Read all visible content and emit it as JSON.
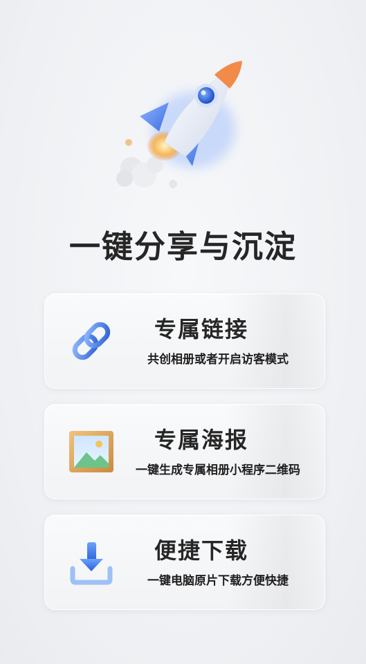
{
  "headline": "一键分享与沉淀",
  "features": [
    {
      "title": "专属链接",
      "subtitle": "共创相册或者开启访客模式",
      "icon": "chain-link-icon"
    },
    {
      "title": "专属海报",
      "subtitle": "一键生成专属相册小程序二维码",
      "icon": "framed-picture-icon"
    },
    {
      "title": "便捷下载",
      "subtitle": "一键电脑原片下载方便快捷",
      "icon": "download-tray-icon"
    }
  ],
  "colors": {
    "accent_blue": "#3d7fe6",
    "rocket_nose": "#f28a4a",
    "frame_gold": "#d8a25a",
    "headline": "#262626"
  }
}
